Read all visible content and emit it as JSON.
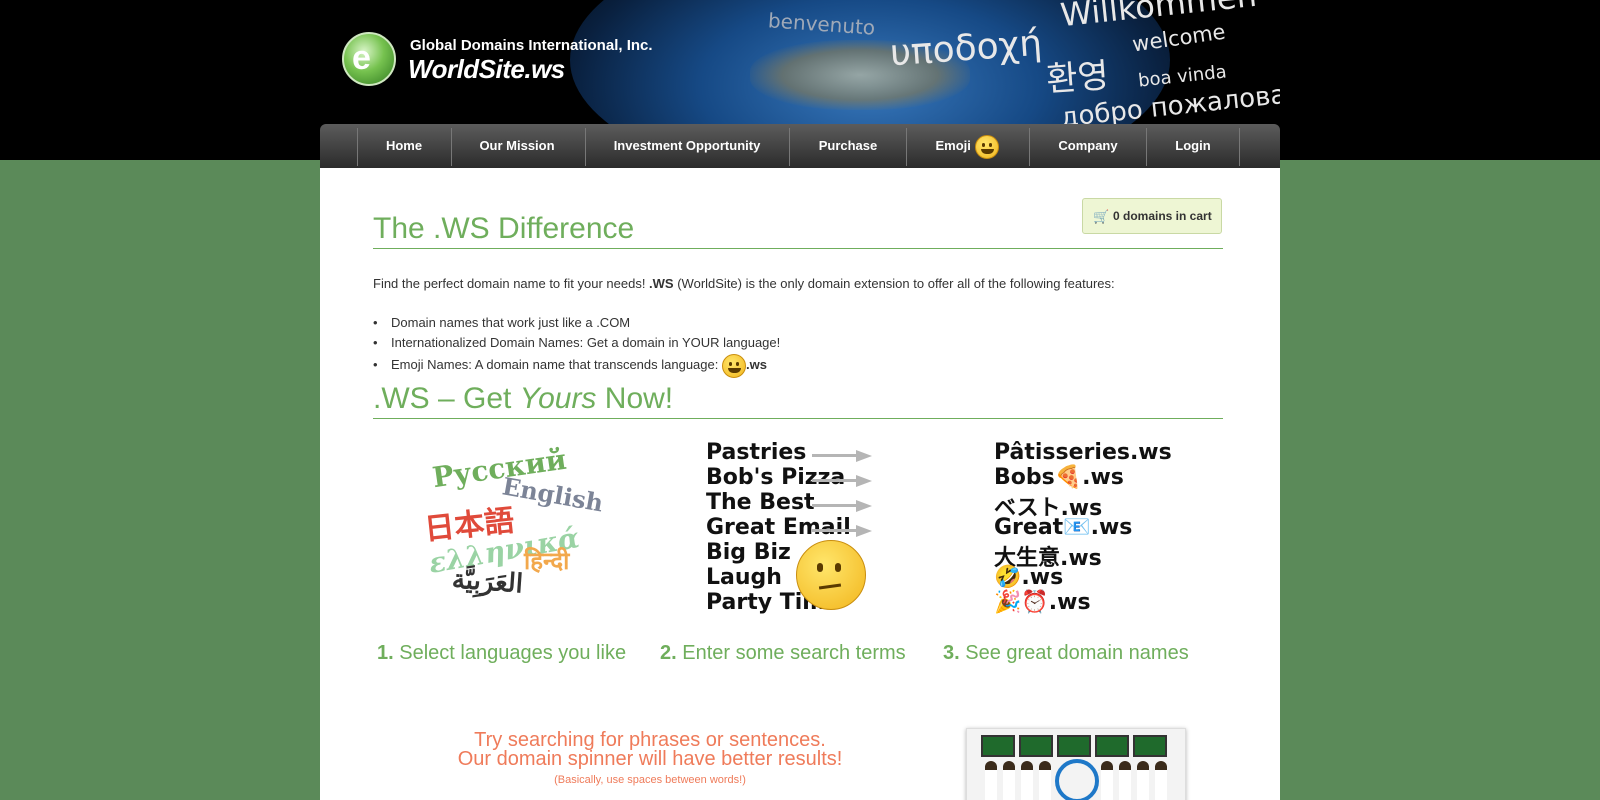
{
  "header": {
    "company_name": "Global Domains International, Inc.",
    "site_name": "WorldSite.ws",
    "logo_glyph": "e",
    "welcome_words": [
      "Willkommen",
      "benvenuto",
      "υποδοχή",
      "welcome",
      "환영",
      "boa vinda",
      "добро пожаловать"
    ]
  },
  "nav": {
    "items": [
      {
        "label": "Home"
      },
      {
        "label": "Our Mission"
      },
      {
        "label": "Investment Opportunity"
      },
      {
        "label": "Purchase"
      },
      {
        "label": "Emoji"
      },
      {
        "label": "Company"
      },
      {
        "label": "Login"
      }
    ]
  },
  "cart": {
    "label": "0 domains in cart",
    "icon": "cart-icon"
  },
  "difference": {
    "title": "The .WS Difference",
    "intro_before": "Find the perfect domain name to fit your needs! ",
    "intro_bold": ".WS",
    "intro_after": " (WorldSite) is the only domain extension to offer all of the following features:",
    "features": [
      "Domain names that work just like a .COM",
      "Internationalized Domain Names: Get a domain in YOUR language!",
      "Emoji Names: A domain name that transcends language: "
    ],
    "emoji_suffix": ".ws"
  },
  "get_yours": {
    "title_before": ".WS – Get ",
    "title_em": "Yours",
    "title_after": " Now!"
  },
  "languages": [
    "Русский",
    "English",
    "日本語",
    "ελληνικά",
    "हिन्दी",
    "العَرَبِيَّة"
  ],
  "search_terms": [
    "Pastries",
    "Bob's Pizza",
    "The Best",
    "Great Email",
    "Big Biz",
    "Laugh",
    "Party Tim"
  ],
  "domains": [
    "Pâtisseries.ws",
    "Bobs🍕.ws",
    "ベスト.ws",
    "Great📧.ws",
    "大生意.ws",
    "🤣.ws",
    "🎉⏰.ws"
  ],
  "steps": [
    {
      "num": "1.",
      "text": " Select languages you like"
    },
    {
      "num": "2.",
      "text": " Enter some search terms"
    },
    {
      "num": "3.",
      "text": " See great domain names"
    }
  ],
  "tip": {
    "line1": "Try searching for phrases or sentences.",
    "line2": "Our domain spinner will have better results!",
    "note": "(Basically, use spaces between words!)"
  },
  "colors": {
    "accent": "#6fae5c",
    "tip": "#ef7b5a",
    "background": "#5b8a59"
  }
}
